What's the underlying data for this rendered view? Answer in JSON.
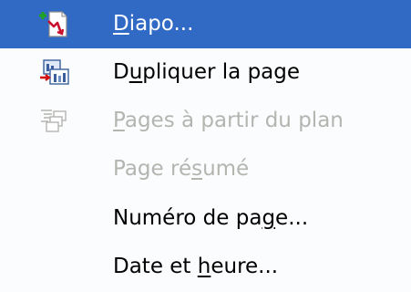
{
  "menu": {
    "items": [
      {
        "label_pre": "",
        "label_mnemonic": "D",
        "label_post": "iapo...",
        "icon": "slide-new-icon",
        "state": "highlighted"
      },
      {
        "label_pre": "D",
        "label_mnemonic": "u",
        "label_post": "pliquer la page",
        "icon": "duplicate-page-icon",
        "state": "normal"
      },
      {
        "label_pre": "",
        "label_mnemonic": "P",
        "label_post": "ages à partir du plan",
        "icon": "pages-from-outline-icon",
        "state": "disabled"
      },
      {
        "label_pre": "Page ré",
        "label_mnemonic": "s",
        "label_post": "umé",
        "icon": "",
        "state": "disabled"
      },
      {
        "label_pre": "Numéro de pa",
        "label_mnemonic": "g",
        "label_post": "e...",
        "icon": "",
        "state": "normal"
      },
      {
        "label_pre": "Date et ",
        "label_mnemonic": "h",
        "label_post": "eure...",
        "icon": "",
        "state": "normal"
      }
    ],
    "colors": {
      "highlight": "#316ac5",
      "highlight_text": "#ffffff",
      "text": "#000000",
      "disabled_text": "#b4b4b0",
      "background": "#fbfcfd"
    }
  }
}
